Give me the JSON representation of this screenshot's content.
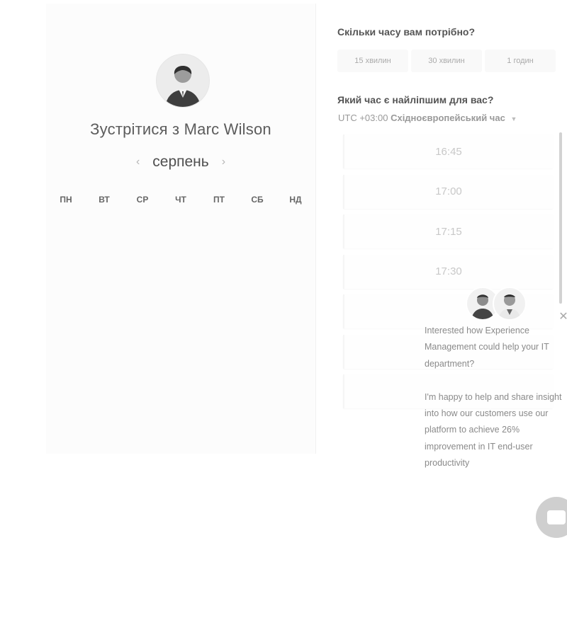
{
  "host": {
    "avatar_icon": "person-avatar",
    "title": "Зустрітися з Marc Wilson"
  },
  "calendar": {
    "month": "серпень",
    "prev_icon": "chevron-left-icon",
    "next_icon": "chevron-right-icon",
    "weekdays": [
      "ПН",
      "ВТ",
      "СР",
      "ЧТ",
      "ПТ",
      "СБ",
      "НД"
    ],
    "days": [
      "",
      "",
      "",
      "",
      "",
      "",
      "",
      "",
      "",
      "",
      "",
      "",
      "",
      "",
      "",
      "",
      "",
      "",
      "",
      "",
      "",
      "",
      "",
      "",
      "",
      "",
      "",
      "",
      "",
      "",
      "",
      "",
      "",
      "",
      ""
    ]
  },
  "duration": {
    "question": "Скільки часу вам потрібно?",
    "options": [
      "15 хвилин",
      "30 хвилин",
      "1 годин"
    ]
  },
  "time": {
    "question": "Який час є найліпшим для вас?",
    "timezone_offset": "UTC +03:00",
    "timezone_name": "Східноєвропейський час",
    "slots": [
      "16:45",
      "17:00",
      "17:15",
      "17:30"
    ]
  },
  "chat": {
    "message": "Interested how Experience Management could help your IT department?\n\nI'm happy to help and share insight into how our customers use our platform to achieve 26% improvement in IT end-user productivity",
    "close_icon": "close-icon",
    "launcher_icon": "chat-bubble-icon"
  }
}
